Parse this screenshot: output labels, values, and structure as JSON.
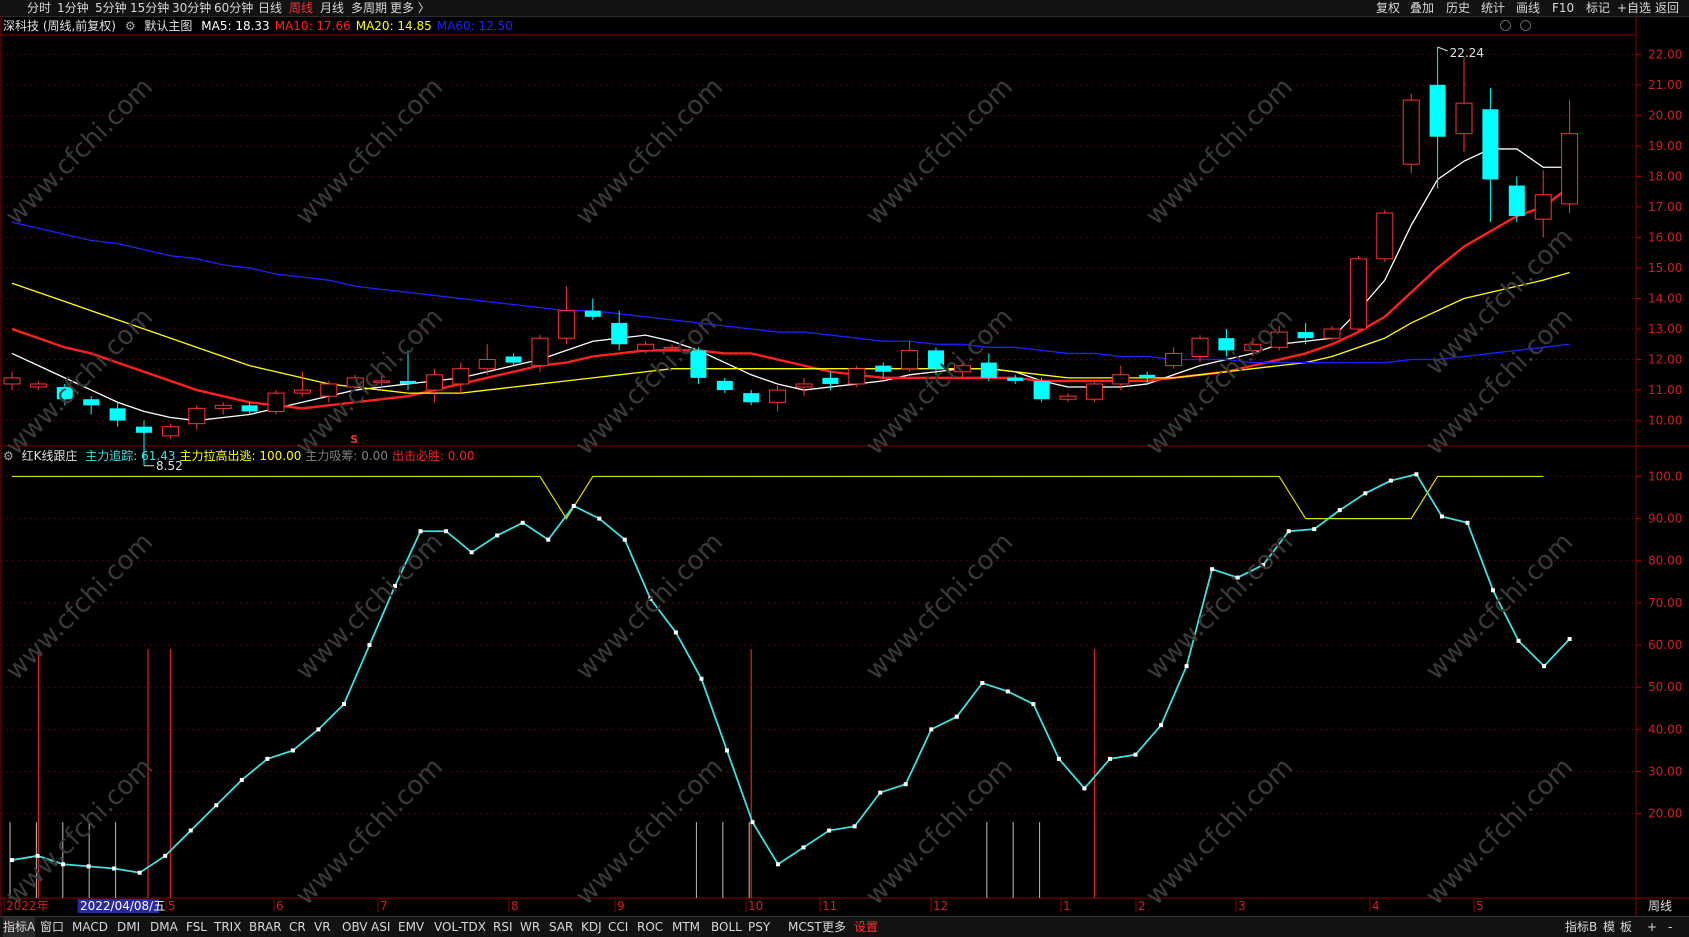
{
  "topbar": {
    "left_tabs": [
      "分时",
      "1分钟",
      "5分钟",
      "15分钟",
      "30分钟",
      "60分钟",
      "日线",
      "周线",
      "月线",
      "多周期",
      "更多 〉"
    ],
    "active_tab": "周线",
    "right_buttons": [
      "复权",
      "叠加",
      "历史",
      "统计",
      "画线",
      "F10",
      "标记",
      "+自选",
      "返回"
    ]
  },
  "main_chart": {
    "stock_label": "深科技 (周线,前复权)",
    "template_label": "默认主图",
    "ma": [
      {
        "label": "MA5: 18.33",
        "color": "#ffffff"
      },
      {
        "label": "MA10: 17.66",
        "color": "#ff2020"
      },
      {
        "label": "MA20: 14.85",
        "color": "#ffff00"
      },
      {
        "label": "MA60: 12.50",
        "color": "#2020ff"
      }
    ],
    "high_label": "22.24",
    "low_label": "8.52",
    "y_ticks": [
      "22.00",
      "21.00",
      "20.00",
      "19.00",
      "18.00",
      "17.00",
      "16.00",
      "15.00",
      "14.00",
      "13.00",
      "12.00",
      "11.00",
      "10.00"
    ],
    "marker": "S"
  },
  "indicator": {
    "name": "红K线跟庄",
    "params": [
      {
        "label": "主力追踪: 61.43",
        "color": "#40e0e0"
      },
      {
        "label": "主力拉高出逃: 100.00",
        "color": "#ffff00"
      },
      {
        "label": "主力吸筹: 0.00",
        "color": "#808080"
      },
      {
        "label": "出击必胜: 0.00",
        "color": "#ff2020"
      }
    ],
    "y_ticks": [
      "100.0",
      "90.00",
      "80.00",
      "70.00",
      "60.00",
      "50.00",
      "40.00",
      "30.00",
      "20.00"
    ]
  },
  "time_axis": {
    "labels": [
      "2022年",
      "2022/04/08/五",
      "5",
      "6",
      "7",
      "8",
      "9",
      "10",
      "11",
      "12",
      "1",
      "2",
      "3",
      "4",
      "5"
    ],
    "period": "周线"
  },
  "bottombar": {
    "tabs": [
      "指标A",
      "窗口",
      "MACD",
      "DMI",
      "DMA",
      "FSL",
      "TRIX",
      "BRAR",
      "CR",
      "VR",
      "OBV",
      "ASI",
      "EMV",
      "VOL-TDX",
      "RSI",
      "WR",
      "SAR",
      "KDJ",
      "CCI",
      "ROC",
      "MTM",
      "BOLL",
      "PSY",
      "MCST",
      "更多",
      "设置"
    ],
    "active_tab": "设置",
    "right": [
      "指标B",
      "模",
      "板",
      "+",
      "-"
    ]
  },
  "watermark": "www.cfchi.com",
  "chart_data": [
    {
      "type": "candlestick",
      "title": "深科技 (周线,前复权)",
      "candles": [
        {
          "o": 11.2,
          "c": 11.4,
          "h": 11.6,
          "l": 11.0
        },
        {
          "o": 11.1,
          "c": 11.2,
          "h": 11.3,
          "l": 11.0
        },
        {
          "o": 11.1,
          "c": 10.7,
          "h": 11.2,
          "l": 10.5
        },
        {
          "o": 10.7,
          "c": 10.5,
          "h": 10.8,
          "l": 10.2
        },
        {
          "o": 10.4,
          "c": 10.0,
          "h": 10.6,
          "l": 9.8
        },
        {
          "o": 9.8,
          "c": 9.6,
          "h": 10.0,
          "l": 8.52
        },
        {
          "o": 9.5,
          "c": 9.8,
          "h": 9.9,
          "l": 9.4
        },
        {
          "o": 9.9,
          "c": 10.4,
          "h": 10.5,
          "l": 9.7
        },
        {
          "o": 10.4,
          "c": 10.5,
          "h": 10.6,
          "l": 10.2
        },
        {
          "o": 10.5,
          "c": 10.3,
          "h": 10.6,
          "l": 10.2
        },
        {
          "o": 10.3,
          "c": 10.9,
          "h": 11.0,
          "l": 10.2
        },
        {
          "o": 10.9,
          "c": 11.0,
          "h": 11.6,
          "l": 10.8
        },
        {
          "o": 10.8,
          "c": 11.2,
          "h": 11.3,
          "l": 10.6
        },
        {
          "o": 11.1,
          "c": 11.4,
          "h": 11.5,
          "l": 11.0
        },
        {
          "o": 11.3,
          "c": 11.3,
          "h": 11.5,
          "l": 11.1
        },
        {
          "o": 11.3,
          "c": 11.2,
          "h": 12.3,
          "l": 11.0
        },
        {
          "o": 11.0,
          "c": 11.5,
          "h": 11.7,
          "l": 10.6
        },
        {
          "o": 11.2,
          "c": 11.7,
          "h": 11.9,
          "l": 10.9
        },
        {
          "o": 11.7,
          "c": 12.0,
          "h": 12.5,
          "l": 11.5
        },
        {
          "o": 12.1,
          "c": 11.9,
          "h": 12.2,
          "l": 11.8
        },
        {
          "o": 11.8,
          "c": 12.7,
          "h": 12.8,
          "l": 11.6
        },
        {
          "o": 12.7,
          "c": 13.6,
          "h": 14.4,
          "l": 12.5
        },
        {
          "o": 13.6,
          "c": 13.4,
          "h": 14.0,
          "l": 13.3
        },
        {
          "o": 13.2,
          "c": 12.5,
          "h": 13.6,
          "l": 12.3
        },
        {
          "o": 12.3,
          "c": 12.5,
          "h": 12.6,
          "l": 12.2
        },
        {
          "o": 12.4,
          "c": 12.4,
          "h": 12.5,
          "l": 12.3
        },
        {
          "o": 12.3,
          "c": 11.4,
          "h": 12.4,
          "l": 11.2
        },
        {
          "o": 11.3,
          "c": 11.0,
          "h": 11.4,
          "l": 10.9
        },
        {
          "o": 10.9,
          "c": 10.6,
          "h": 11.0,
          "l": 10.5
        },
        {
          "o": 10.6,
          "c": 11.0,
          "h": 11.2,
          "l": 10.3
        },
        {
          "o": 11.1,
          "c": 11.2,
          "h": 11.4,
          "l": 10.8
        },
        {
          "o": 11.4,
          "c": 11.2,
          "h": 11.6,
          "l": 11.0
        },
        {
          "o": 11.2,
          "c": 11.7,
          "h": 11.8,
          "l": 11.1
        },
        {
          "o": 11.8,
          "c": 11.6,
          "h": 11.9,
          "l": 11.4
        },
        {
          "o": 11.7,
          "c": 12.3,
          "h": 12.6,
          "l": 11.6
        },
        {
          "o": 12.3,
          "c": 11.7,
          "h": 12.4,
          "l": 11.5
        },
        {
          "o": 11.6,
          "c": 11.8,
          "h": 11.9,
          "l": 11.4
        },
        {
          "o": 11.9,
          "c": 11.4,
          "h": 12.2,
          "l": 11.3
        },
        {
          "o": 11.4,
          "c": 11.3,
          "h": 11.5,
          "l": 11.2
        },
        {
          "o": 11.3,
          "c": 10.7,
          "h": 11.4,
          "l": 10.6
        },
        {
          "o": 10.7,
          "c": 10.8,
          "h": 10.9,
          "l": 10.6
        },
        {
          "o": 10.7,
          "c": 11.2,
          "h": 11.3,
          "l": 10.6
        },
        {
          "o": 11.2,
          "c": 11.5,
          "h": 11.8,
          "l": 11.0
        },
        {
          "o": 11.5,
          "c": 11.4,
          "h": 11.6,
          "l": 11.2
        },
        {
          "o": 11.8,
          "c": 12.2,
          "h": 12.4,
          "l": 11.7
        },
        {
          "o": 12.1,
          "c": 12.7,
          "h": 12.8,
          "l": 11.9
        },
        {
          "o": 12.7,
          "c": 12.3,
          "h": 13.0,
          "l": 12.1
        },
        {
          "o": 12.3,
          "c": 12.5,
          "h": 12.7,
          "l": 12.1
        },
        {
          "o": 12.4,
          "c": 12.9,
          "h": 13.1,
          "l": 12.3
        },
        {
          "o": 12.9,
          "c": 12.7,
          "h": 13.2,
          "l": 12.5
        },
        {
          "o": 12.7,
          "c": 13.0,
          "h": 13.1,
          "l": 12.6
        },
        {
          "o": 13.0,
          "c": 15.3,
          "h": 15.4,
          "l": 12.9
        },
        {
          "o": 15.3,
          "c": 16.8,
          "h": 16.9,
          "l": 15.2
        },
        {
          "o": 18.4,
          "c": 20.5,
          "h": 20.7,
          "l": 18.1
        },
        {
          "o": 21.0,
          "c": 19.3,
          "h": 22.24,
          "l": 17.6
        },
        {
          "o": 19.4,
          "c": 20.4,
          "h": 21.9,
          "l": 18.8
        },
        {
          "o": 20.2,
          "c": 17.9,
          "h": 20.9,
          "l": 16.5
        },
        {
          "o": 17.7,
          "c": 16.7,
          "h": 18.0,
          "l": 16.5
        },
        {
          "o": 16.6,
          "c": 17.4,
          "h": 18.2,
          "l": 16.0
        },
        {
          "o": 17.1,
          "c": 19.4,
          "h": 20.5,
          "l": 16.8
        }
      ],
      "ma_series": [
        {
          "name": "MA5",
          "color": "#ffffff",
          "start": 0,
          "values": [
            12.2,
            11.8,
            11.4,
            11.0,
            10.6,
            10.3,
            10.1,
            10.0,
            10.1,
            10.2,
            10.4,
            10.6,
            10.8,
            11.0,
            11.1,
            11.2,
            11.3,
            11.4,
            11.6,
            11.8,
            12.0,
            12.3,
            12.6,
            12.7,
            12.8,
            12.6,
            12.3,
            11.9,
            11.5,
            11.2,
            11.0,
            11.1,
            11.2,
            11.3,
            11.5,
            11.6,
            11.7,
            11.7,
            11.6,
            11.3,
            11.1,
            11.1,
            11.1,
            11.2,
            11.5,
            11.8,
            12.0,
            12.2,
            12.5,
            12.6,
            12.7,
            13.6,
            14.6,
            16.4,
            17.9,
            18.5,
            18.9,
            18.9,
            18.3,
            18.3
          ]
        },
        {
          "name": "MA10",
          "color": "#ff2020",
          "start": 0,
          "values": [
            13.0,
            12.7,
            12.4,
            12.2,
            11.9,
            11.6,
            11.3,
            11.0,
            10.8,
            10.6,
            10.5,
            10.4,
            10.5,
            10.6,
            10.7,
            10.8,
            11.0,
            11.2,
            11.4,
            11.6,
            11.8,
            11.9,
            12.1,
            12.2,
            12.3,
            12.3,
            12.3,
            12.2,
            12.2,
            12.0,
            11.8,
            11.6,
            11.5,
            11.4,
            11.4,
            11.4,
            11.4,
            11.4,
            11.4,
            11.3,
            11.3,
            11.3,
            11.3,
            11.3,
            11.4,
            11.5,
            11.6,
            11.8,
            12.0,
            12.2,
            12.5,
            12.9,
            13.4,
            14.2,
            15.0,
            15.7,
            16.2,
            16.7,
            17.0,
            17.66
          ]
        },
        {
          "name": "MA20",
          "color": "#ffff00",
          "start": 0,
          "values": [
            14.5,
            14.2,
            13.9,
            13.6,
            13.3,
            13.0,
            12.7,
            12.4,
            12.1,
            11.8,
            11.6,
            11.4,
            11.2,
            11.1,
            11.0,
            10.9,
            10.9,
            10.9,
            11.0,
            11.1,
            11.2,
            11.3,
            11.4,
            11.5,
            11.6,
            11.7,
            11.7,
            11.7,
            11.7,
            11.7,
            11.7,
            11.7,
            11.7,
            11.7,
            11.7,
            11.7,
            11.7,
            11.7,
            11.6,
            11.5,
            11.4,
            11.4,
            11.4,
            11.4,
            11.4,
            11.5,
            11.6,
            11.7,
            11.8,
            11.9,
            12.1,
            12.4,
            12.7,
            13.2,
            13.6,
            14.0,
            14.2,
            14.4,
            14.6,
            14.85
          ]
        },
        {
          "name": "MA60",
          "color": "#2020ff",
          "start": 0,
          "values": [
            16.5,
            16.3,
            16.1,
            15.9,
            15.8,
            15.6,
            15.4,
            15.3,
            15.1,
            15.0,
            14.8,
            14.7,
            14.6,
            14.4,
            14.3,
            14.2,
            14.1,
            14.0,
            13.9,
            13.8,
            13.7,
            13.6,
            13.6,
            13.5,
            13.4,
            13.3,
            13.2,
            13.1,
            13.0,
            12.9,
            12.9,
            12.8,
            12.7,
            12.6,
            12.6,
            12.5,
            12.5,
            12.4,
            12.4,
            12.3,
            12.2,
            12.2,
            12.1,
            12.1,
            12.0,
            12.0,
            12.0,
            11.9,
            11.9,
            11.9,
            11.9,
            11.9,
            11.9,
            12.0,
            12.0,
            12.1,
            12.2,
            12.3,
            12.4,
            12.5
          ]
        }
      ],
      "ylim": [
        9.2,
        22.6
      ]
    },
    {
      "type": "line",
      "title": "红K线跟庄",
      "series": [
        {
          "name": "主力追踪",
          "color": "#40e0e0",
          "values": [
            9,
            10,
            8,
            7.5,
            7,
            6,
            10,
            16,
            22,
            28,
            33,
            35,
            40,
            46,
            60,
            74,
            87,
            87,
            82,
            86,
            89,
            85,
            93,
            90,
            85,
            71,
            63,
            52,
            35,
            18,
            8,
            12,
            16,
            17,
            25,
            27,
            40,
            43,
            51,
            49,
            46,
            33,
            26,
            33,
            34,
            41,
            55,
            78,
            76,
            79,
            87,
            87.5,
            92,
            96,
            99,
            100.5,
            90.5,
            89,
            73,
            61,
            55,
            61.43
          ]
        },
        {
          "name": "主力拉高出逃",
          "color": "#ffff00",
          "values": [
            100,
            100,
            100,
            100,
            100,
            100,
            100,
            100,
            100,
            100,
            100,
            100,
            100,
            100,
            100,
            100,
            100,
            100,
            100,
            100,
            100,
            90,
            100,
            100,
            100,
            100,
            100,
            100,
            100,
            100,
            100,
            100,
            100,
            100,
            100,
            100,
            100,
            100,
            100,
            100,
            100,
            100,
            100,
            100,
            100,
            100,
            100,
            100,
            100,
            90,
            90,
            90,
            90,
            90,
            100,
            100,
            100,
            100,
            100
          ]
        }
      ],
      "ylim": [
        0,
        102
      ]
    }
  ]
}
